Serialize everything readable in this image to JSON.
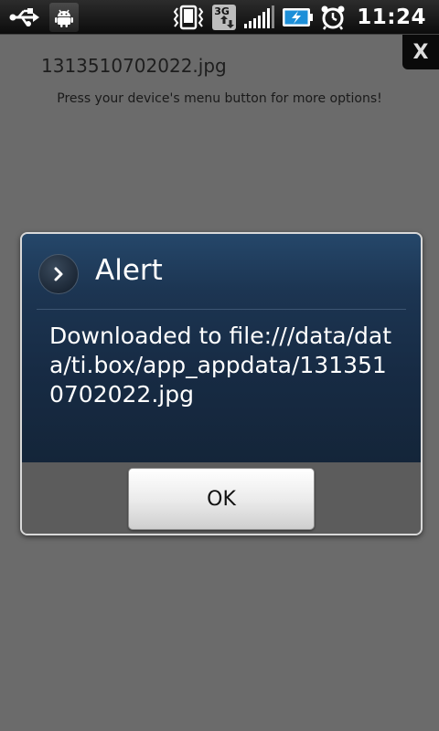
{
  "status_bar": {
    "time": "11:24",
    "network": "3G",
    "icons": [
      "usb-icon",
      "android-debug-icon",
      "vibrate-icon",
      "3g-icon",
      "signal-icon",
      "battery-charging-icon",
      "alarm-icon"
    ]
  },
  "page": {
    "file_name": "1313510702022.jpg",
    "hint": "Press your device's menu button for more options!",
    "close_label": "X"
  },
  "dialog": {
    "title": "Alert",
    "message": "Downloaded to file:///data/data/ti.box/app_appdata/1313510702022.jpg",
    "ok_label": "OK"
  },
  "colors": {
    "background": "#6b6b6b",
    "dialog_header": "#1c3552",
    "dialog_footer": "#5c5c5c"
  }
}
